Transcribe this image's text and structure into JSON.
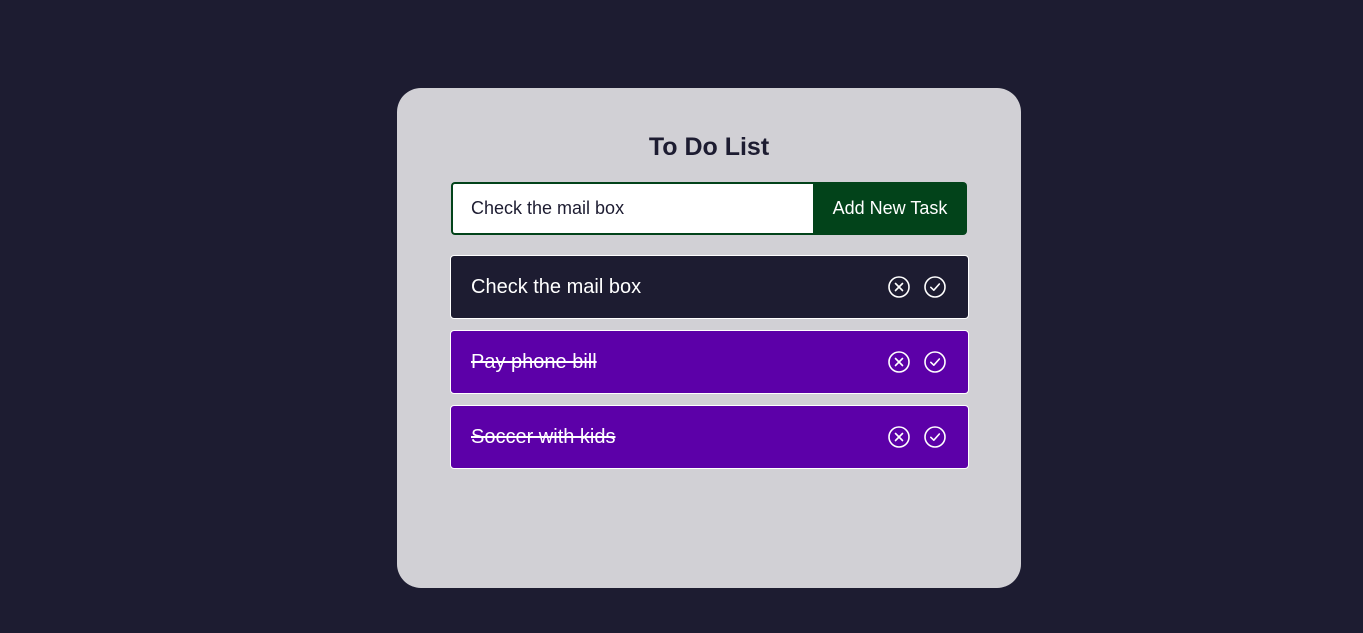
{
  "app": {
    "title": "To Do List"
  },
  "form": {
    "input_value": "Check the mail box",
    "button_label": "Add New Task"
  },
  "tasks": [
    {
      "text": "Check the mail box",
      "completed": false,
      "delete_icon": "circle-x-icon",
      "complete_icon": "circle-check-icon"
    },
    {
      "text": "Pay phone bill",
      "completed": true,
      "delete_icon": "circle-x-icon",
      "complete_icon": "circle-check-icon"
    },
    {
      "text": "Soccer with kids",
      "completed": true,
      "delete_icon": "circle-x-icon",
      "complete_icon": "circle-check-icon"
    }
  ],
  "colors": {
    "page_background": "#1d1c31",
    "card_background": "#d1d0d5",
    "button_green": "#02431a",
    "pending_task": "#1d1c31",
    "completed_task": "#5c00a8"
  }
}
